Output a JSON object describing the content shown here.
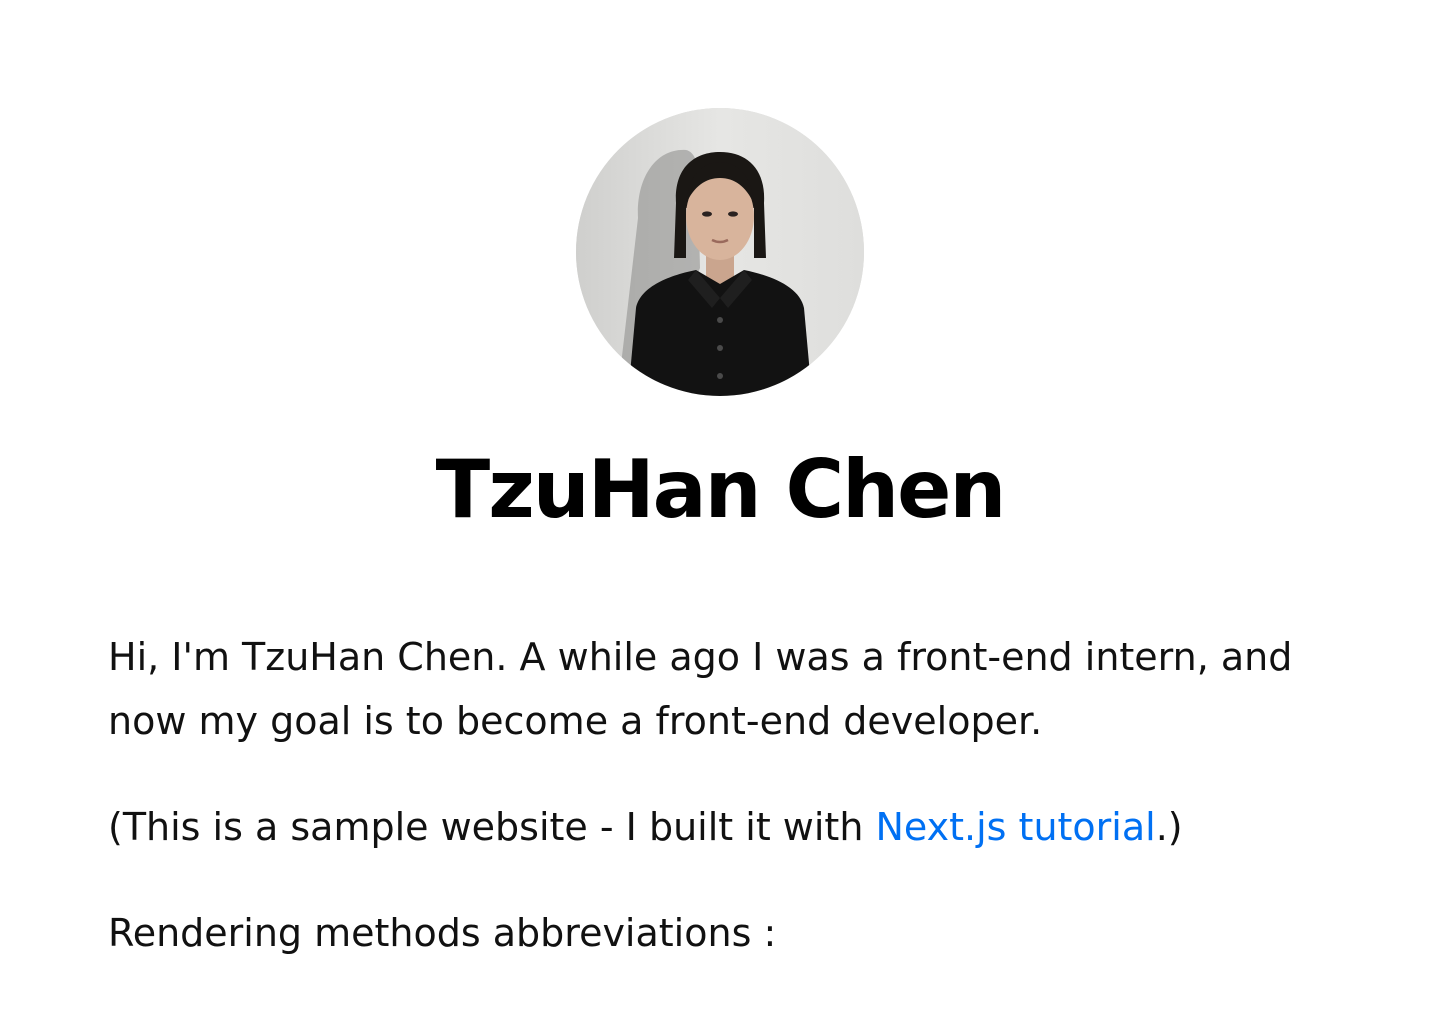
{
  "profile": {
    "name": "TzuHan Chen",
    "avatar_icon": "profile-photo"
  },
  "intro": {
    "text": "Hi, I'm TzuHan Chen. A while ago I was a front-end intern, and now my goal is to become a front-end developer."
  },
  "sample": {
    "prefix": "(This is a sample website - I built it with ",
    "link_text": "Next.js tutorial",
    "suffix": ".)"
  },
  "rendering": {
    "heading": "Rendering methods abbreviations :"
  },
  "colors": {
    "link": "#0070f3",
    "text": "#111111",
    "background": "#ffffff"
  }
}
